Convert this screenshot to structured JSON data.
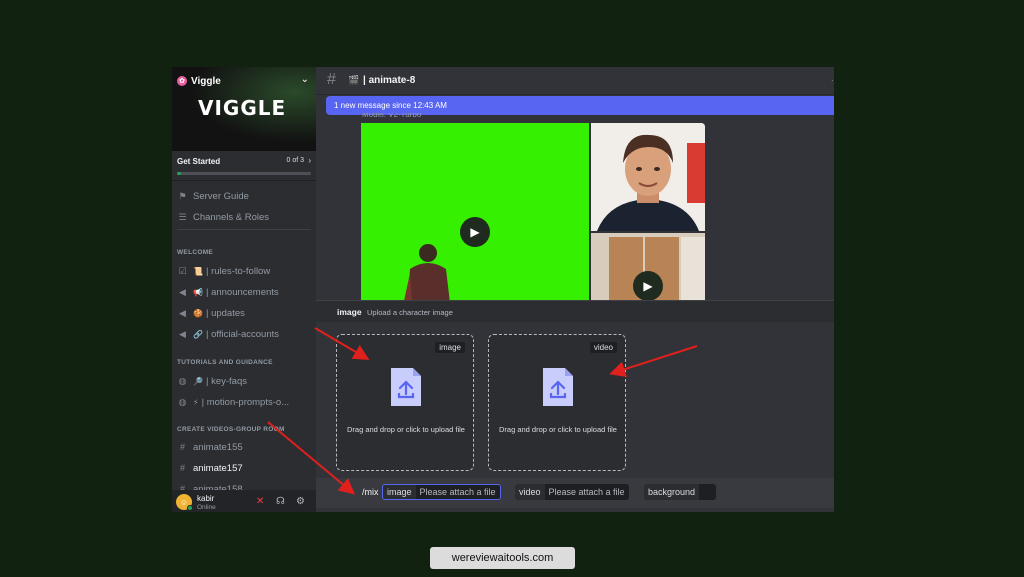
{
  "colors": {
    "page_bg": "#112210",
    "accent": "#5865f2",
    "online": "#23a55a",
    "arrow": "#e0201c"
  },
  "server": {
    "name": "Viggle",
    "logo_text": "VIGGLE",
    "chevron_icon": "chevron-down-icon"
  },
  "get_started": {
    "label": "Get Started",
    "count": "0 of 3",
    "progress": 0.0
  },
  "sidebar": {
    "top_items": [
      {
        "label": "Server Guide",
        "icon": "signpost-icon"
      },
      {
        "label": "Channels & Roles",
        "icon": "list-icon"
      }
    ],
    "categories": [
      {
        "label": "WELCOME"
      },
      {
        "label": "TUTORIALS AND GUIDANCE"
      },
      {
        "label": "CREATE VIDEOS-GROUP ROOM"
      }
    ],
    "welcome_channels": [
      {
        "name": "| rules-to-follow",
        "emoji": "📜"
      },
      {
        "name": "| announcements",
        "emoji": "📢"
      },
      {
        "name": "| updates",
        "emoji": "🍪"
      },
      {
        "name": "| official-accounts",
        "emoji": "🔗"
      }
    ],
    "tutorial_channels": [
      {
        "name": "| key-faqs",
        "emoji": "🔎"
      },
      {
        "name": "| motion-prompts-o...",
        "emoji": "⚡"
      }
    ],
    "room_channels": [
      {
        "name": "animate155",
        "active": false
      },
      {
        "name": "animate157",
        "active": true
      },
      {
        "name": "animate158",
        "active": false
      }
    ]
  },
  "user": {
    "name": "kabir",
    "status": "Online"
  },
  "channel": {
    "name": "| animate-8",
    "emoji": "🎬"
  },
  "new_message_banner": "1 new message since 12:43 AM",
  "model_line": "Model: V2-Turbo",
  "command_option": {
    "name": "image",
    "description": "Upload a character image"
  },
  "upload_boxes": [
    {
      "tag": "image",
      "text": "Drag and drop or click to upload file"
    },
    {
      "tag": "video",
      "text": "Drag and drop or click to upload file"
    }
  ],
  "command_bar": {
    "command": "/mix",
    "params": [
      {
        "key": "image",
        "value": "Please attach a file"
      },
      {
        "key": "video",
        "value": "Please attach a file"
      },
      {
        "key": "background",
        "value": ""
      }
    ]
  },
  "footer": {
    "site": "wereviewaitools.com"
  }
}
